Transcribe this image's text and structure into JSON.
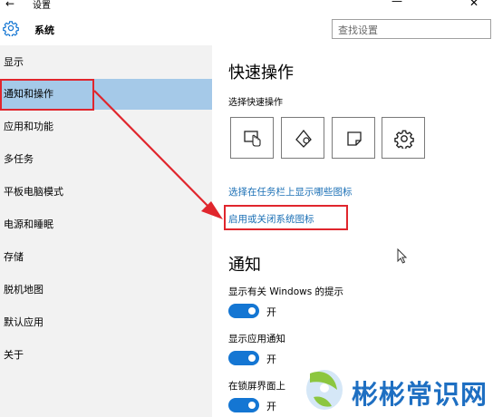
{
  "window": {
    "back_label": "←",
    "title": "设置",
    "minimize_label": "—",
    "close_label": "✕"
  },
  "header": {
    "icon": "gear-icon",
    "title": "系统",
    "search_placeholder": "查找设置"
  },
  "sidebar": {
    "items": [
      {
        "label": "显示",
        "selected": false
      },
      {
        "label": "通知和操作",
        "selected": true
      },
      {
        "label": "应用和功能",
        "selected": false
      },
      {
        "label": "多任务",
        "selected": false
      },
      {
        "label": "平板电脑模式",
        "selected": false
      },
      {
        "label": "电源和睡眠",
        "selected": false
      },
      {
        "label": "存储",
        "selected": false
      },
      {
        "label": "脱机地图",
        "selected": false
      },
      {
        "label": "默认应用",
        "selected": false
      },
      {
        "label": "关于",
        "selected": false
      }
    ]
  },
  "main": {
    "quick_actions_title": "快速操作",
    "quick_actions_subtitle": "选择快速操作",
    "quick_action_icons": [
      "tablet-mode-icon",
      "location-icon",
      "note-icon",
      "settings-icon"
    ],
    "link_taskbar_icons": "选择在任务栏上显示哪些图标",
    "link_system_icons": "启用或关闭系统图标",
    "notifications_title": "通知",
    "options": [
      {
        "label": "显示有关 Windows 的提示",
        "state": "开",
        "on": true
      },
      {
        "label": "显示应用通知",
        "state": "开",
        "on": true
      },
      {
        "label": "在锁屏界面上",
        "state": "开",
        "on": true
      }
    ]
  },
  "annotation": {
    "color": "#e0262d"
  },
  "accent_color": "#1476d3",
  "watermark": {
    "text": "彬彬常识网"
  }
}
